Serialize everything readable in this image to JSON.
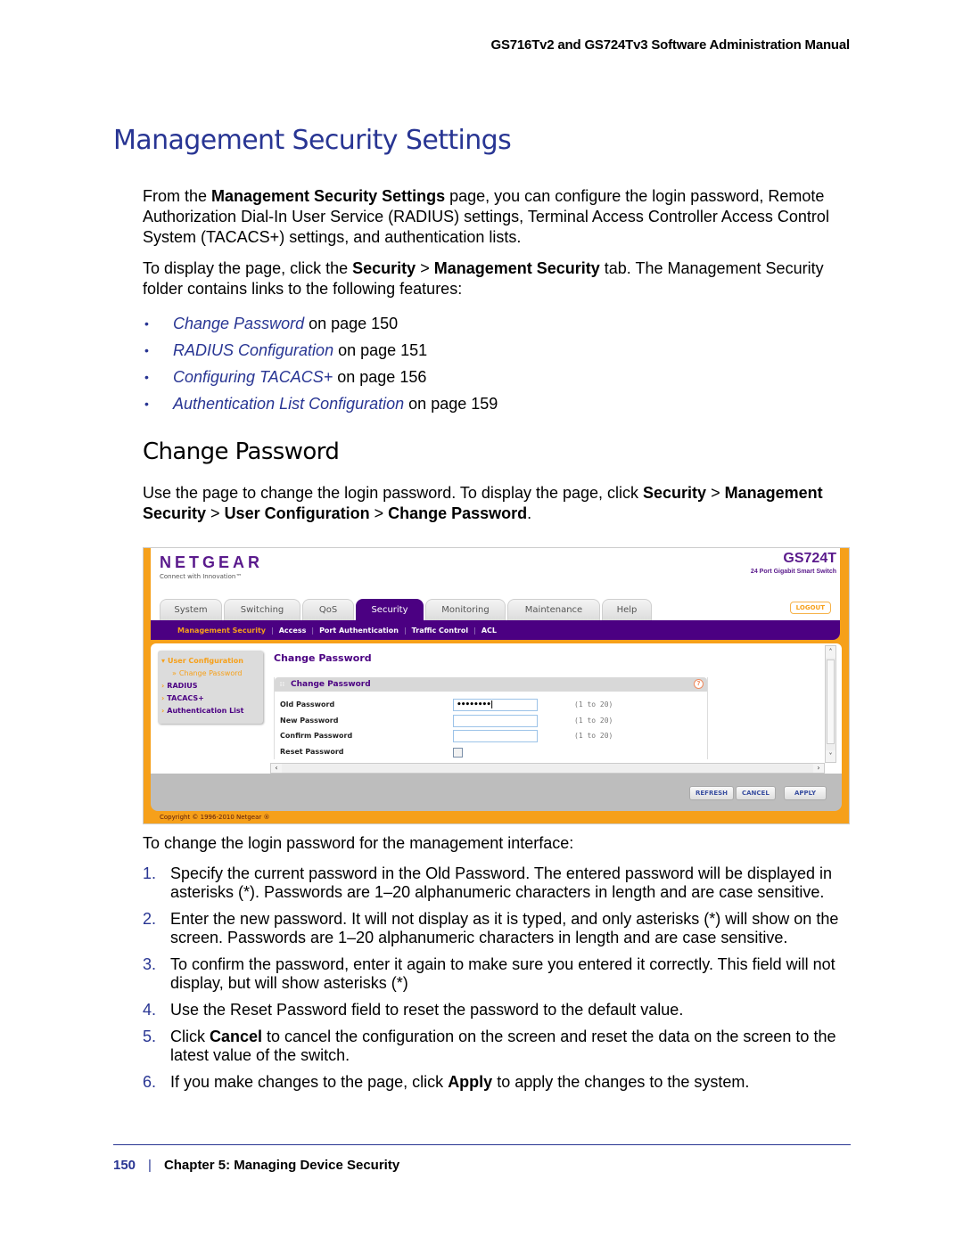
{
  "header": {
    "running_title": "GS716Tv2 and GS724Tv3 Software Administration Manual"
  },
  "section": {
    "title": "Management Security Settings",
    "intro_p1": {
      "pre": "From the ",
      "bold": "Management Security Settings",
      "post": " page, you can configure the login password, Remote Authorization Dial-In User Service (RADIUS) settings, Terminal Access Controller Access Control System (TACACS+) settings, and authentication lists."
    },
    "intro_p2": {
      "pre": "To display the page, click the ",
      "b1": "Security",
      "sep": " > ",
      "b2": "Management Security",
      "post": " tab. The Management Security folder contains links to the following features:"
    },
    "links": [
      {
        "bullet": "•",
        "label": "Change Password",
        "suffix": " on page 150"
      },
      {
        "bullet": "•",
        "label": "RADIUS Configuration",
        "suffix": " on page 151"
      },
      {
        "bullet": "•",
        "label": "Configuring TACACS+",
        "suffix": " on page 156"
      },
      {
        "bullet": "•",
        "label": "Authentication List Configuration",
        "suffix": " on page 159"
      }
    ]
  },
  "subsection": {
    "title": "Change Password",
    "intro": {
      "pre": "Use the page to change the login password. To display the page, click ",
      "b1": "Security",
      "sep1": " > ",
      "b2": "Management Security",
      "sep2": " > ",
      "b3": "User Configuration",
      "sep3": " > ",
      "b4": "Change Password",
      "post": "."
    },
    "lead": "To change the login password for the management interface:",
    "steps": [
      {
        "num": "1.",
        "pre": "Specify the current password in the Old Password. The entered password will be displayed in asterisks (*). Passwords are 1–20 alphanumeric characters in length and are case sensitive.",
        "bold": "",
        "post": ""
      },
      {
        "num": "2.",
        "pre": "Enter the new password. It will not display as it is typed, and only asterisks (*) will show on the screen. Passwords are 1–20 alphanumeric characters in length and are case sensitive.",
        "bold": "",
        "post": ""
      },
      {
        "num": "3.",
        "pre": "To confirm the password, enter it again to make sure you entered it correctly. This field will not display, but will show asterisks (*)",
        "bold": "",
        "post": ""
      },
      {
        "num": "4.",
        "pre": "Use the Reset Password field to reset the password to the default value.",
        "bold": "",
        "post": ""
      },
      {
        "num": "5.",
        "pre": "Click ",
        "bold": "Cancel",
        "post": " to cancel the configuration on the screen and reset the data on the screen to the latest value of the switch."
      },
      {
        "num": "6.",
        "pre": "If you make changes to the page, click ",
        "bold": "Apply",
        "post": " to apply the changes to the system."
      }
    ]
  },
  "screenshot": {
    "logo": "NETGEAR",
    "tagline": "Connect with Innovation™",
    "model": "GS724T",
    "model_sub": "24 Port Gigabit Smart Switch",
    "logout": "LOGOUT",
    "tabs": [
      "System",
      "Switching",
      "QoS",
      "Security",
      "Monitoring",
      "Maintenance",
      "Help"
    ],
    "active_tab": "Security",
    "subnav": [
      "Management Security",
      "Access",
      "Port Authentication",
      "Traffic Control",
      "ACL"
    ],
    "subnav_sep": "|",
    "leftnav": [
      {
        "arrow": "▾",
        "label": "User Configuration"
      },
      {
        "arrow": "»",
        "label": "Change Password"
      },
      {
        "arrow": "›",
        "label": "RADIUS"
      },
      {
        "arrow": "›",
        "label": "TACACS+"
      },
      {
        "arrow": "›",
        "label": "Authentication List"
      }
    ],
    "page_title": "Change Password",
    "panel_title": "Change Password",
    "panel_grip": "∷",
    "help_icon": "?",
    "fields": [
      {
        "label": "Old Password",
        "value": "••••••••|",
        "range": "(1 to 20)"
      },
      {
        "label": "New Password",
        "value": "",
        "range": "(1 to 20)"
      },
      {
        "label": "Confirm Password",
        "value": "",
        "range": "(1 to 20)"
      },
      {
        "label": "Reset Password",
        "checked": false
      }
    ],
    "scroll_up": "˄",
    "scroll_down": "˅",
    "scroll_left": "‹",
    "scroll_right": "›",
    "buttons": {
      "refresh": "REFRESH",
      "cancel": "CANCEL",
      "apply": "APPLY"
    },
    "copyright": "Copyright © 1996-2010 Netgear ®",
    "colors": {
      "brand_purple": "#4b0082",
      "brand_orange": "#f6a01a"
    }
  },
  "footer": {
    "page_number": "150",
    "separator": "|",
    "chapter": "Chapter 5:  Managing Device Security"
  },
  "colors": {
    "doc_blue": "#283593"
  }
}
